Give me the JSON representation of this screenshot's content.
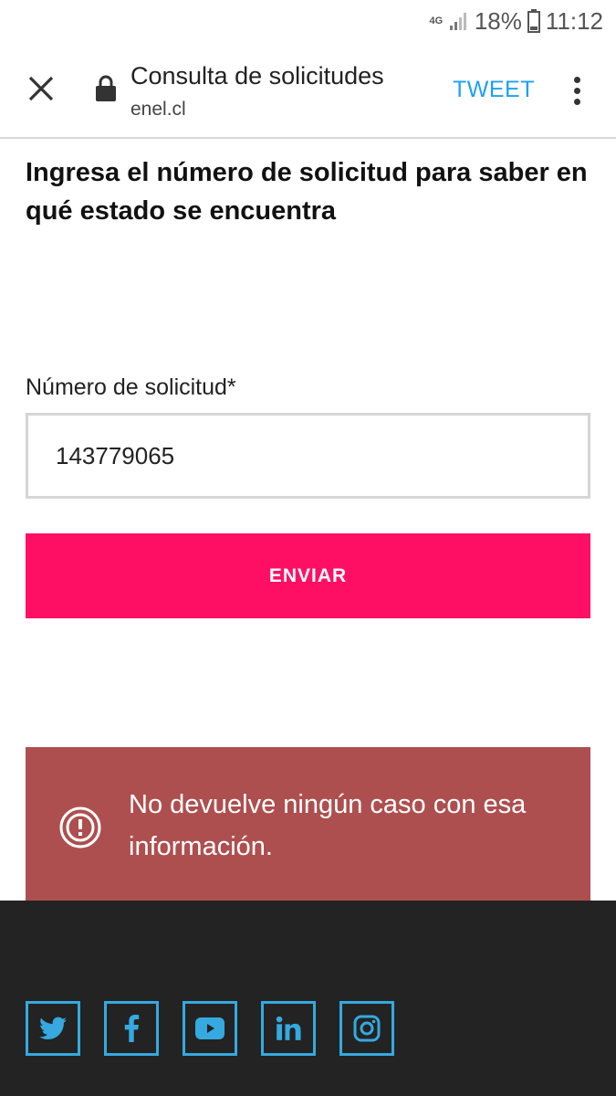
{
  "status_bar": {
    "network": "4G",
    "battery": "18%",
    "time": "11:12"
  },
  "toolbar": {
    "title": "Consulta de solicitudes",
    "domain": "enel.cl",
    "tweet_label": "TWEET"
  },
  "main": {
    "heading": "Ingresa el número de solicitud para saber en qué estado se encuentra",
    "field_label": "Número de solicitud*",
    "field_value": "143779065",
    "submit_label": "ENVIAR",
    "error_message": "No devuelve ningún caso con esa información."
  },
  "footer": {
    "social_icons": [
      "twitter-icon",
      "facebook-icon",
      "youtube-icon",
      "linkedin-icon",
      "instagram-icon"
    ]
  },
  "colors": {
    "accent": "#ff0f64",
    "error_bg": "#ae4f4f",
    "tweet_blue": "#1da1f2",
    "social_blue": "#35a9e0",
    "footer_bg": "#232323"
  }
}
